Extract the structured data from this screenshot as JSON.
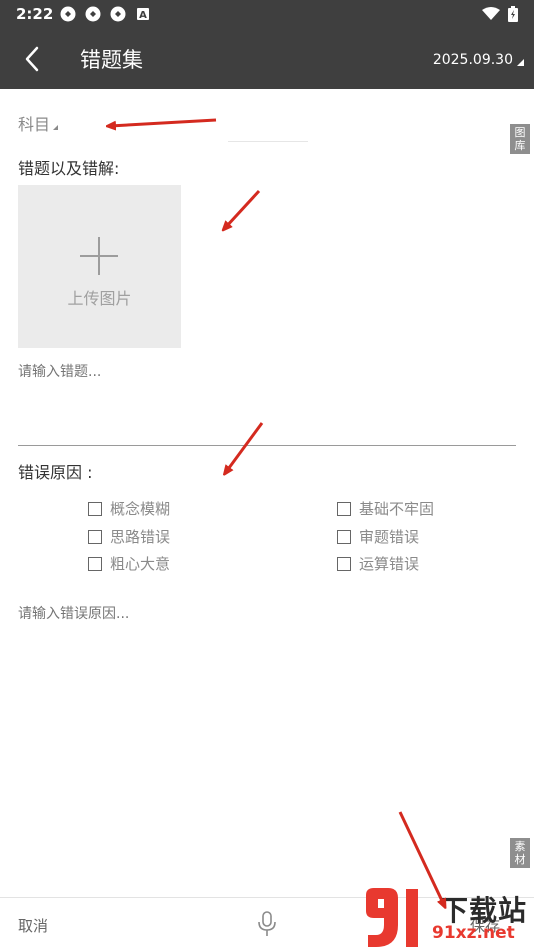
{
  "status_bar": {
    "time": "2:22",
    "icons": [
      "sync-icon",
      "sync-icon",
      "sync-icon",
      "a-badge-icon"
    ],
    "right_icons": [
      "wifi-icon",
      "battery-icon"
    ]
  },
  "app_bar": {
    "title": "错题集",
    "date": "2025.09.30",
    "back_icon": "chevron-left-icon"
  },
  "form": {
    "subject_label": "科目",
    "side_tab_top": [
      "图",
      "库"
    ],
    "mistake_label": "错题以及错解:",
    "upload_label": "上传图片",
    "mistake_placeholder": "请输入错题...",
    "reason_label": "错误原因 :",
    "reasons": [
      {
        "label": "概念模糊",
        "checked": false
      },
      {
        "label": "基础不牢固",
        "checked": false
      },
      {
        "label": "思路错误",
        "checked": false
      },
      {
        "label": "审题错误",
        "checked": false
      },
      {
        "label": "粗心大意",
        "checked": false
      },
      {
        "label": "运算错误",
        "checked": false
      }
    ],
    "reason_placeholder": "请输入错误原因...",
    "side_tab_bottom": [
      "素",
      "材"
    ]
  },
  "bottom_bar": {
    "cancel_label": "取消",
    "mic_icon": "microphone-icon",
    "save_label": "保存"
  },
  "watermark": {
    "logo_text": "下载站",
    "url_text": "91xz.net"
  },
  "colors": {
    "bar_background": "#3f3f3f",
    "annotation_arrow": "#d42a1f",
    "upload_box": "#ebebeb"
  }
}
